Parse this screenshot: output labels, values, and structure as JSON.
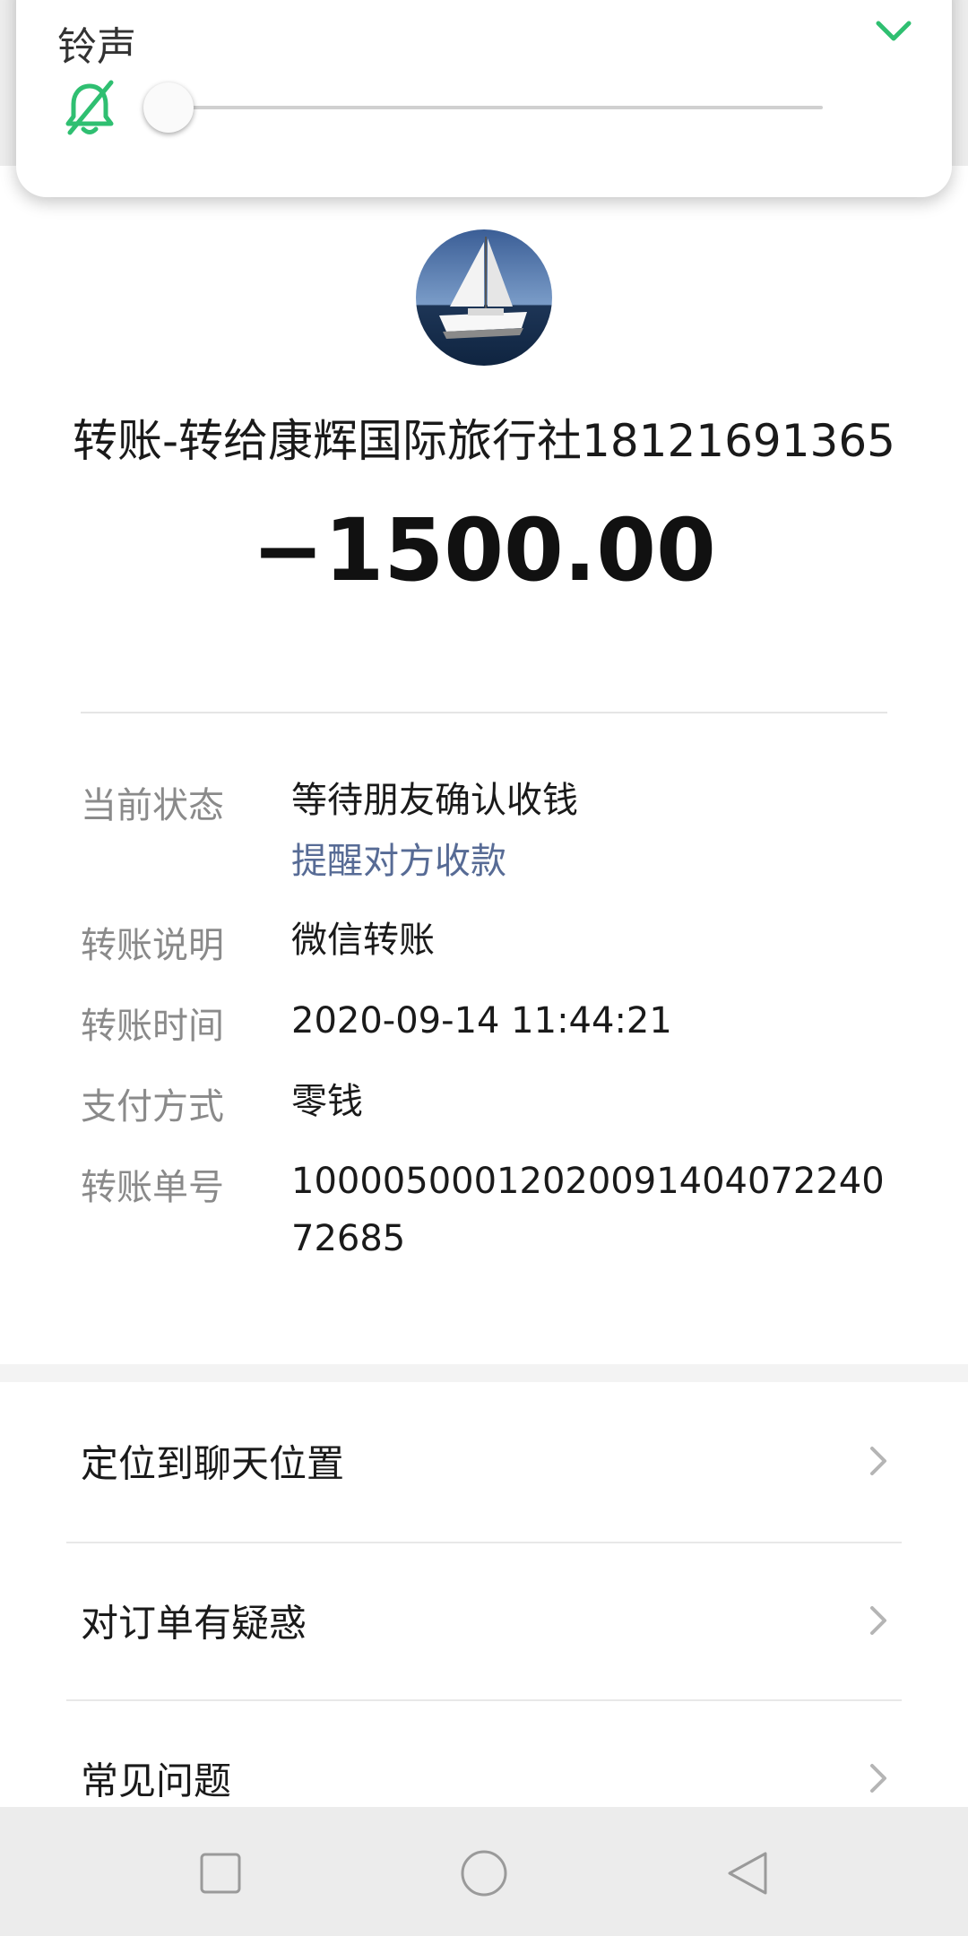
{
  "volume_panel": {
    "title": "铃声",
    "level": 0,
    "accent_color": "#2fbf71",
    "icons": {
      "mute": "bell-off-icon",
      "collapse": "chevron-down-icon"
    }
  },
  "transfer": {
    "payee": "转账-转给康辉国际旅行社18121691365",
    "amount": "−1500.00",
    "avatar": "sailboat-avatar"
  },
  "details": {
    "status_label": "当前状态",
    "status_value": "等待朋友确认收钱",
    "remind_link": "提醒对方收款",
    "note_label": "转账说明",
    "note_value": "微信转账",
    "time_label": "转账时间",
    "time_value": "2020-09-14 11:44:21",
    "method_label": "支付方式",
    "method_value": "零钱",
    "order_label": "转账单号",
    "order_value": "1000050001202009140407224072685"
  },
  "menu": {
    "items": [
      {
        "label": "定位到聊天位置"
      },
      {
        "label": "对订单有疑惑"
      },
      {
        "label": "常见问题"
      }
    ]
  },
  "navbar": {
    "icons": [
      "recent-apps-icon",
      "home-icon",
      "back-icon"
    ]
  },
  "colors": {
    "link": "#576b95",
    "label": "#8a8a8a",
    "accent": "#2fbf71"
  }
}
